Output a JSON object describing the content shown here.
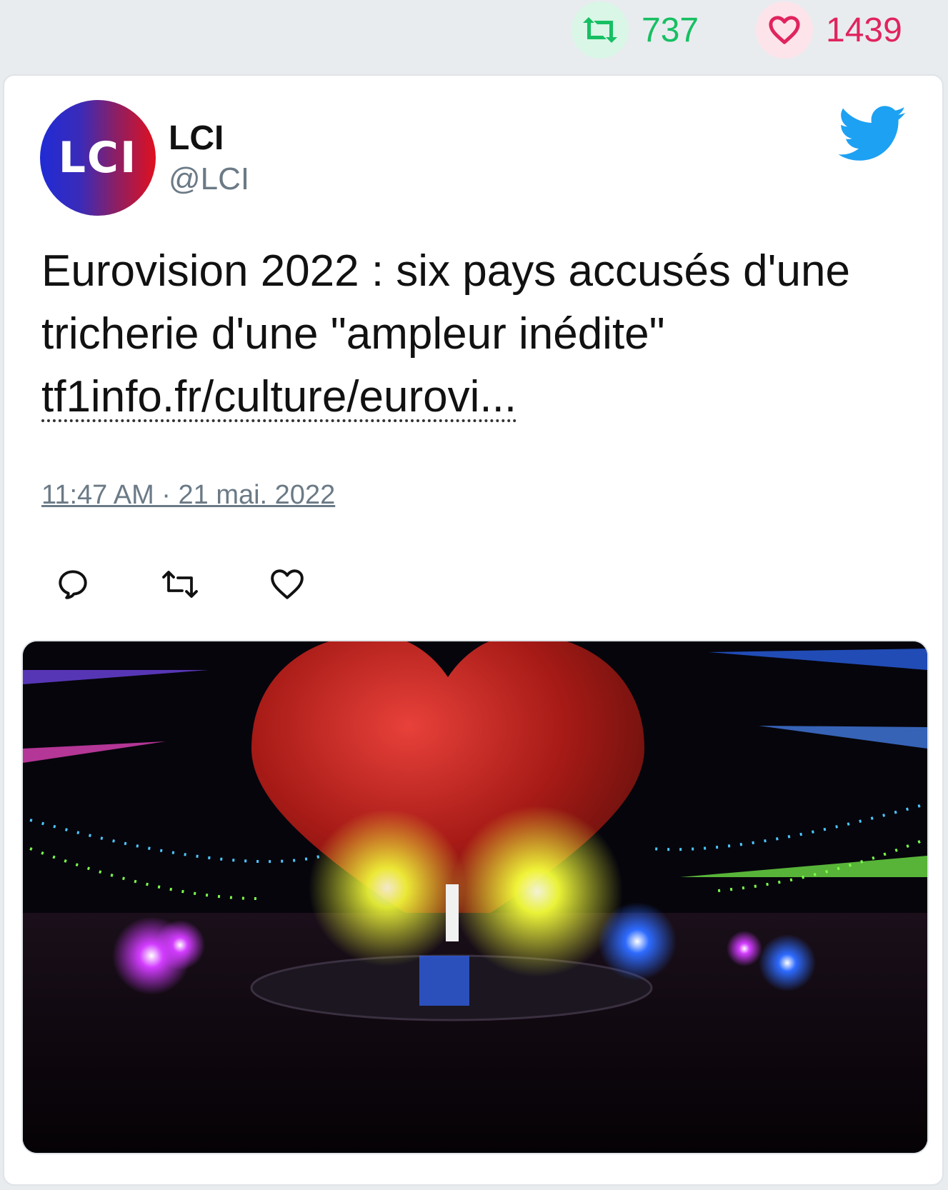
{
  "stats": {
    "retweets": {
      "icon": "retweet-icon",
      "count": "737",
      "color": "#17bf63"
    },
    "likes": {
      "icon": "heart-icon",
      "count": "1439",
      "color": "#e0245e"
    }
  },
  "tweet": {
    "author": {
      "avatar_text": "LCI",
      "display_name": "LCI",
      "handle": "@LCI"
    },
    "platform_icon": "twitter-bird-icon",
    "text_line": "Eurovision 2022 : six pays accusés d'une tricherie d'une \"ampleur inédite\"",
    "link": "tf1info.fr/culture/eurovi...",
    "timestamp": "11:47 AM · 21 mai. 2022",
    "actions": [
      {
        "name": "reply",
        "icon": "reply-icon"
      },
      {
        "name": "retweet",
        "icon": "retweet-icon"
      },
      {
        "name": "like",
        "icon": "heart-icon"
      }
    ],
    "media": {
      "alt_icon": "photo",
      "colors": {
        "heart": "#c8241f",
        "light_yellow": "#f6ff3a",
        "light_blue": "#2e6bff",
        "light_purple": "#d23cff"
      }
    }
  },
  "colors": {
    "page_background": "#e9ecef",
    "card_background": "#ffffff",
    "twitter_blue": "#1da1f2",
    "muted_text": "#6b7a86"
  }
}
